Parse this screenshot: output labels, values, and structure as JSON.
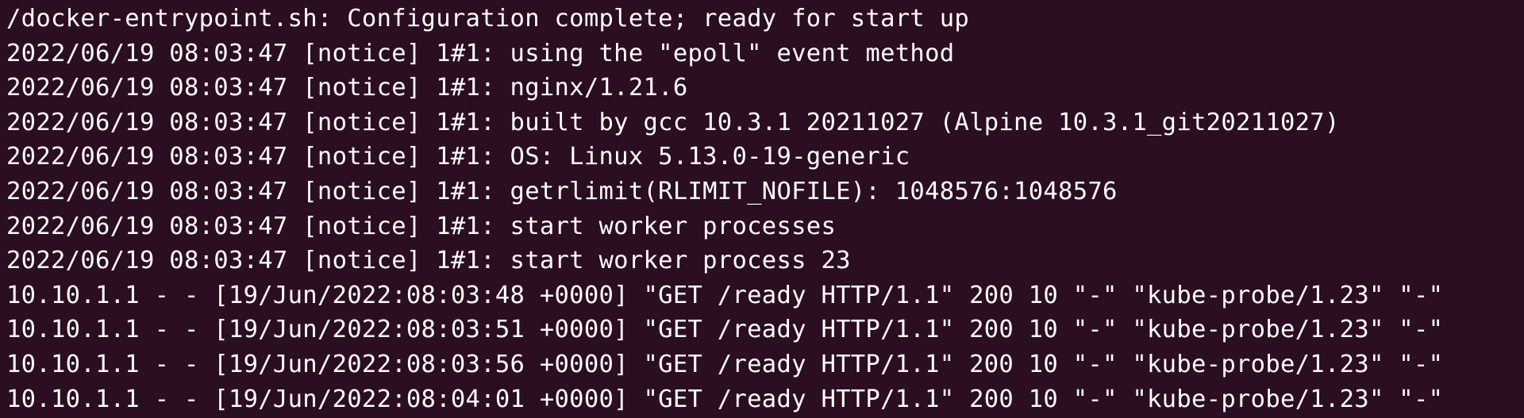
{
  "terminal": {
    "background": "#2b0e22",
    "foreground": "#ffffff",
    "lines": [
      "/docker-entrypoint.sh: Configuration complete; ready for start up",
      "2022/06/19 08:03:47 [notice] 1#1: using the \"epoll\" event method",
      "2022/06/19 08:03:47 [notice] 1#1: nginx/1.21.6",
      "2022/06/19 08:03:47 [notice] 1#1: built by gcc 10.3.1 20211027 (Alpine 10.3.1_git20211027)",
      "2022/06/19 08:03:47 [notice] 1#1: OS: Linux 5.13.0-19-generic",
      "2022/06/19 08:03:47 [notice] 1#1: getrlimit(RLIMIT_NOFILE): 1048576:1048576",
      "2022/06/19 08:03:47 [notice] 1#1: start worker processes",
      "2022/06/19 08:03:47 [notice] 1#1: start worker process 23",
      "10.10.1.1 - - [19/Jun/2022:08:03:48 +0000] \"GET /ready HTTP/1.1\" 200 10 \"-\" \"kube-probe/1.23\" \"-\"",
      "10.10.1.1 - - [19/Jun/2022:08:03:51 +0000] \"GET /ready HTTP/1.1\" 200 10 \"-\" \"kube-probe/1.23\" \"-\"",
      "10.10.1.1 - - [19/Jun/2022:08:03:56 +0000] \"GET /ready HTTP/1.1\" 200 10 \"-\" \"kube-probe/1.23\" \"-\"",
      "10.10.1.1 - - [19/Jun/2022:08:04:01 +0000] \"GET /ready HTTP/1.1\" 200 10 \"-\" \"kube-probe/1.23\" \"-\""
    ]
  }
}
